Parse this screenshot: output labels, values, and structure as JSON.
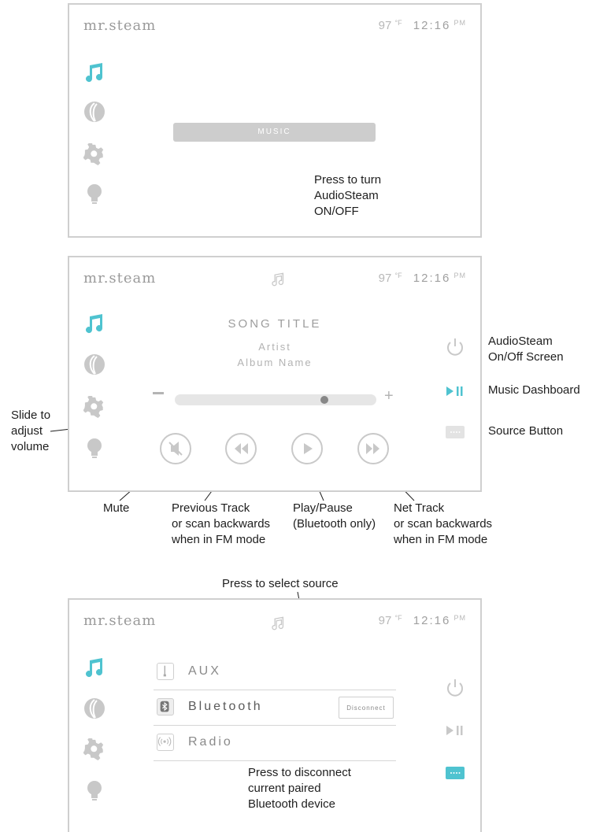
{
  "header": {
    "logo": "mr.steam",
    "temperature": "97",
    "temp_unit": "°F",
    "time": "12:16",
    "ampm": "PM"
  },
  "screen1": {
    "music_button": "MUSIC",
    "callout": [
      "Press to turn",
      "AudioSteam",
      "ON/OFF"
    ]
  },
  "screen2": {
    "song_title": "SONG TITLE",
    "artist": "Artist",
    "album": "Album Name",
    "volume_level": 0.75,
    "volume_minus": "−",
    "volume_plus": "+",
    "right_labels": {
      "power": [
        "AudioSteam",
        "On/Off Screen"
      ],
      "dashboard": "Music Dashboard",
      "source": "Source Button"
    },
    "left_label": [
      "Slide to",
      "adjust",
      "volume"
    ],
    "bottom_labels": {
      "mute": "Mute",
      "previous": [
        "Previous Track",
        "or scan backwards",
        "when in FM mode"
      ],
      "play": [
        "Play/Pause",
        "(Bluetooth only)"
      ],
      "next": [
        "Net Track",
        "or scan backwards",
        "when in FM mode"
      ]
    }
  },
  "screen3": {
    "top_label": "Press to select source",
    "sources": [
      {
        "label": "AUX",
        "icon": "aux-jack-icon"
      },
      {
        "label": "Bluetooth",
        "icon": "bluetooth-icon"
      },
      {
        "label": "Radio",
        "icon": "radio-icon"
      }
    ],
    "disconnect": "Disconnect",
    "callout": [
      "Press to disconnect",
      "current paired",
      "Bluetooth device"
    ]
  },
  "colors": {
    "accent": "#4fc3d0",
    "inactive": "#c8c8c8",
    "border": "#cfcfcf"
  }
}
